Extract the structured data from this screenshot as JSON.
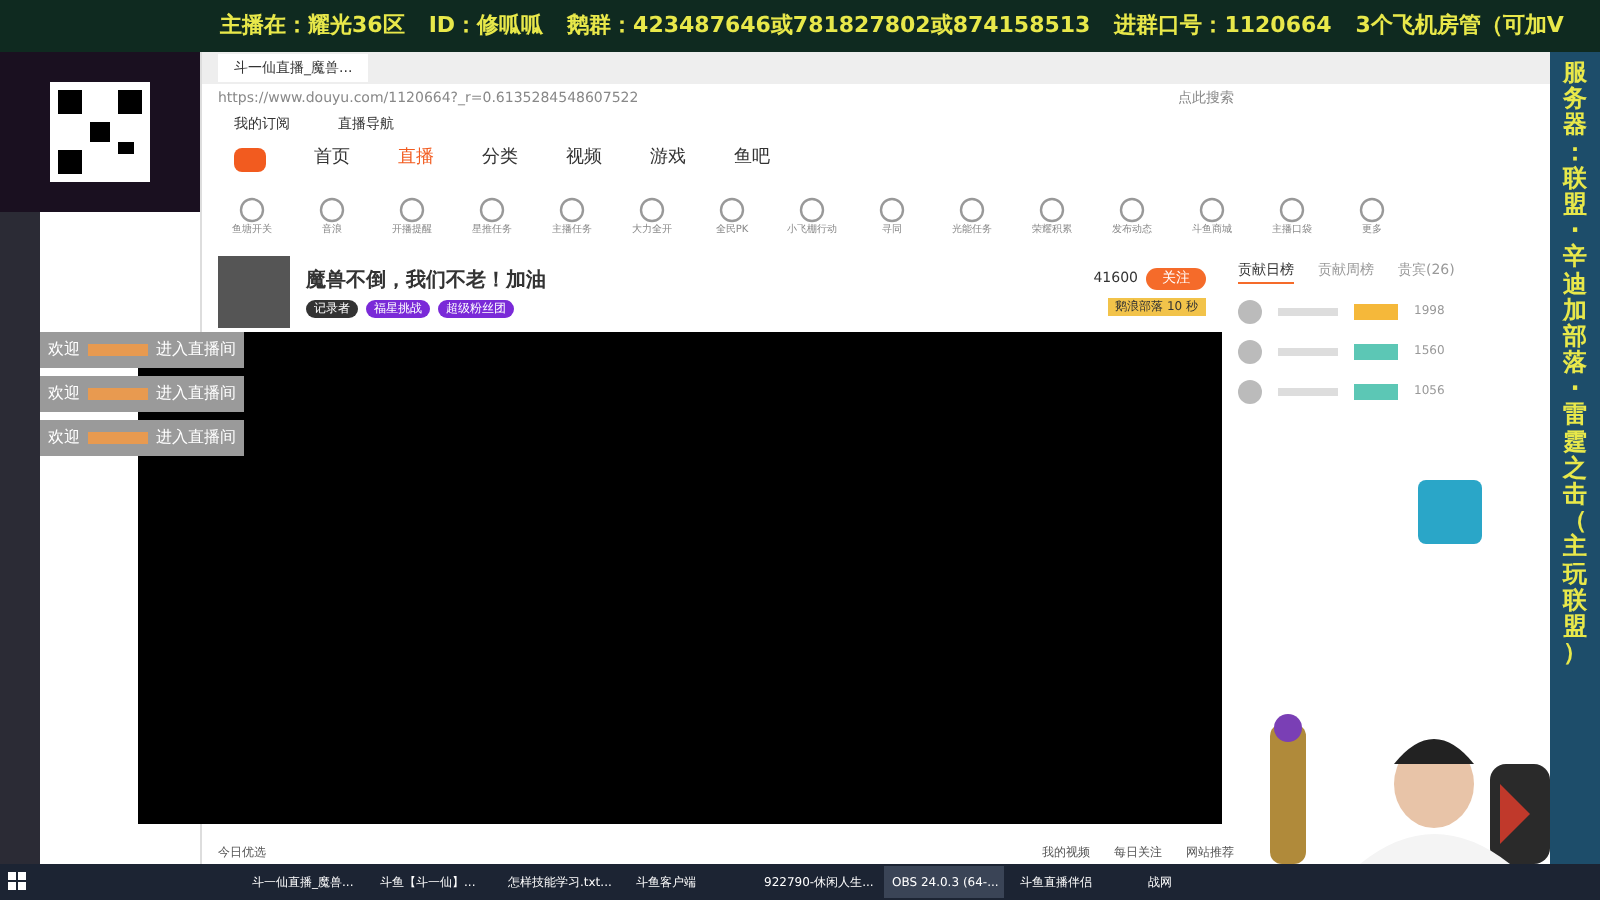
{
  "banner": [
    "主播在：耀光36区",
    "ID：修呱呱",
    "鹅群：423487646或781827802或874158513",
    "进群口号：1120664",
    "3个飞机房管（可加V"
  ],
  "side_banner": "服务器：联盟·辛迪加部落·雷霆之击（主玩联盟）",
  "browser": {
    "tab_title": "斗一仙直播_魔兽...",
    "url": "https://www.douyu.com/1120664?_r=0.6135284548607522",
    "search_placeholder": "点此搜索",
    "bookmarks": [
      "我的订阅",
      "直播导航"
    ]
  },
  "nav": [
    {
      "label": "首页",
      "selected": false
    },
    {
      "label": "直播",
      "selected": true
    },
    {
      "label": "分类",
      "selected": false
    },
    {
      "label": "视频",
      "selected": false
    },
    {
      "label": "游戏",
      "selected": false
    },
    {
      "label": "鱼吧",
      "selected": false
    }
  ],
  "tools": [
    "鱼塘开关",
    "音浪",
    "开播提醒",
    "星推任务",
    "主播任务",
    "大力全开",
    "全民PK",
    "小飞棚行动",
    "寻同",
    "光能任务",
    "荣耀积累",
    "发布动态",
    "斗鱼商城",
    "主播口袋",
    "更多"
  ],
  "room": {
    "title": "魔兽不倒，我们不老！加油",
    "fans": "41600",
    "follow": "关注",
    "badges": [
      "记录者",
      "福星挑战",
      "超级粉丝团"
    ],
    "gift_banner": "鹅浪部落 10 秒"
  },
  "rank": {
    "tabs": [
      {
        "label": "贡献日榜",
        "selected": true
      },
      {
        "label": "贡献周榜",
        "selected": false
      },
      {
        "label": "贵宾(26)",
        "selected": false
      }
    ],
    "rows": [
      {
        "value": "1998"
      },
      {
        "value": "1560"
      },
      {
        "value": "1056"
      }
    ]
  },
  "welcome": [
    {
      "prefix": "欢迎",
      "suffix": "进入直播间"
    },
    {
      "prefix": "欢迎",
      "suffix": "进入直播间"
    },
    {
      "prefix": "欢迎",
      "suffix": "进入直播间"
    }
  ],
  "status": {
    "left": "今日优选",
    "right": [
      "我的视频",
      "每日关注",
      "网站推荐"
    ]
  },
  "taskbar": [
    {
      "label": "斗一仙直播_魔兽...",
      "selected": false
    },
    {
      "label": "斗鱼【斗一仙】...",
      "selected": false
    },
    {
      "label": "怎样技能学习.txt...",
      "selected": false
    },
    {
      "label": "斗鱼客户端",
      "selected": false
    },
    {
      "label": "922790-休闲人生...",
      "selected": false
    },
    {
      "label": "OBS 24.0.3 (64-...",
      "selected": true
    },
    {
      "label": "斗鱼直播伴侣",
      "selected": false
    },
    {
      "label": "战网",
      "selected": false
    }
  ]
}
